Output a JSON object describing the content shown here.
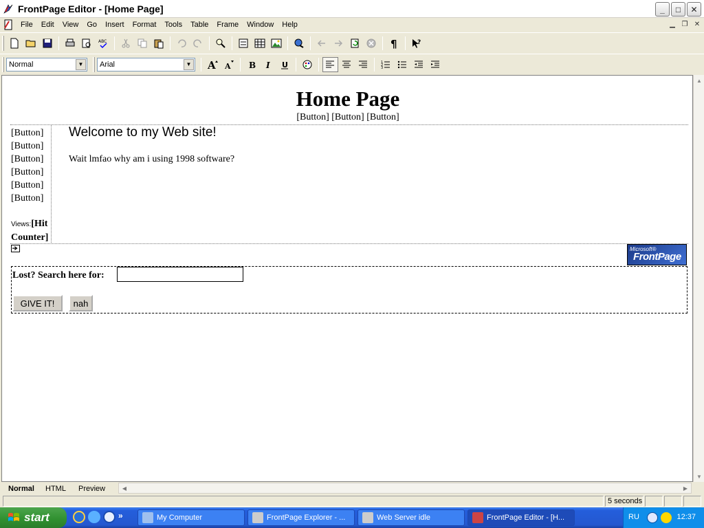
{
  "window": {
    "title": "FrontPage Editor - [Home Page]",
    "controls": {
      "minimize": "_",
      "maximize": "□",
      "close": "✕"
    }
  },
  "menu": {
    "items": [
      "File",
      "Edit",
      "View",
      "Go",
      "Insert",
      "Format",
      "Tools",
      "Table",
      "Frame",
      "Window",
      "Help"
    ]
  },
  "toolbar": {
    "style_select": "Normal",
    "font_select": "Arial"
  },
  "page": {
    "title": "Home Page",
    "top_nav": "[Button] [Button] [Button]",
    "side_nav": [
      "[Button]",
      "[Button]",
      "[Button]",
      "[Button]",
      "[Button]",
      "[Button]"
    ],
    "welcome": "Welcome to my Web site!",
    "body_text": "Wait lmfao why am i using 1998 software?",
    "views_label": "Views:",
    "hit_counter_line1": "[Hit",
    "hit_counter_line2": "Counter]",
    "logo_small": "Microsoft®",
    "logo_big": "FrontPage",
    "search_label": "Lost? Search here for:",
    "search_value": "",
    "submit_label": "GIVE IT!",
    "reset_label": "nah"
  },
  "tabs": {
    "normal": "Normal",
    "html": "HTML",
    "preview": "Preview"
  },
  "status": {
    "download_time": "5 seconds"
  },
  "taskbar": {
    "start_label": "start",
    "buttons": [
      "My Computer",
      "FrontPage Explorer - ...",
      "Web Server idle",
      "FrontPage Editor - [H..."
    ],
    "language": "RU",
    "clock": "12:37"
  },
  "colors": {
    "taskbar_blue": "#245edb",
    "start_green": "#2f8f2f",
    "tray_blue": "#0f8eea",
    "chrome": "#ece9d8"
  }
}
